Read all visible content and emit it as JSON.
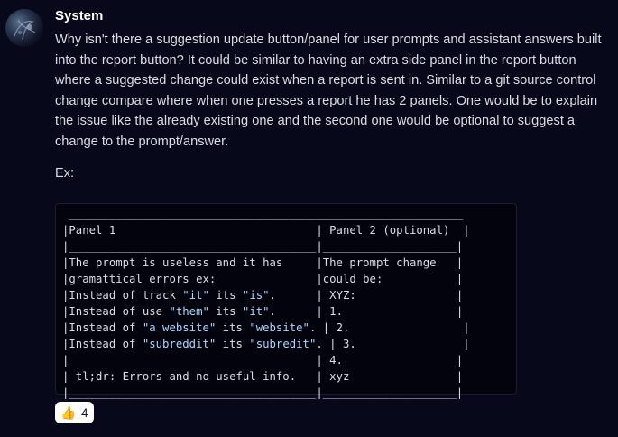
{
  "author": {
    "name": "System"
  },
  "message": {
    "text": "Why isn't there a suggestion update button/panel for user prompts and assistant answers built into the report button? It could be similar to having an extra side panel in the report button where a suggested change could exist when a report is sent in. Similar to a git source control change compare where when one presses a report he has 2 panels. One would be to explain the issue like the already existing one and the second one would be optional to suggest a change to the prompt/answer.",
    "ex_label": "Ex:"
  },
  "code": {
    "lines": [
      " ___________________________________________________________",
      "|Panel 1                              | Panel 2 (optional)  |",
      "|_____________________________________|____________________|",
      "|The prompt is useless and it has     |The prompt change   |",
      "|gramattical errors ex:               |could be:           |",
      "|Instead of track \"it\" its \"is\".      | XYZ:               |",
      "|Instead of use \"them\" its \"it\".      | 1.                 |",
      "|Instead of \"a website\" its \"website\". | 2.                 |",
      "|Instead of \"subreddit\" its \"subredit\". | 3.                |",
      "|                                     | 4.                 |",
      "| tl;dr: Errors and no useful info.   | xyz                |",
      "|_____________________________________|____________________|"
    ]
  },
  "reaction": {
    "icon": "thumbs-up-icon",
    "emoji": "👍",
    "count": "4"
  },
  "colors": {
    "background": "#070819",
    "code_background": "#02030c",
    "string": "#a8d8ff"
  }
}
